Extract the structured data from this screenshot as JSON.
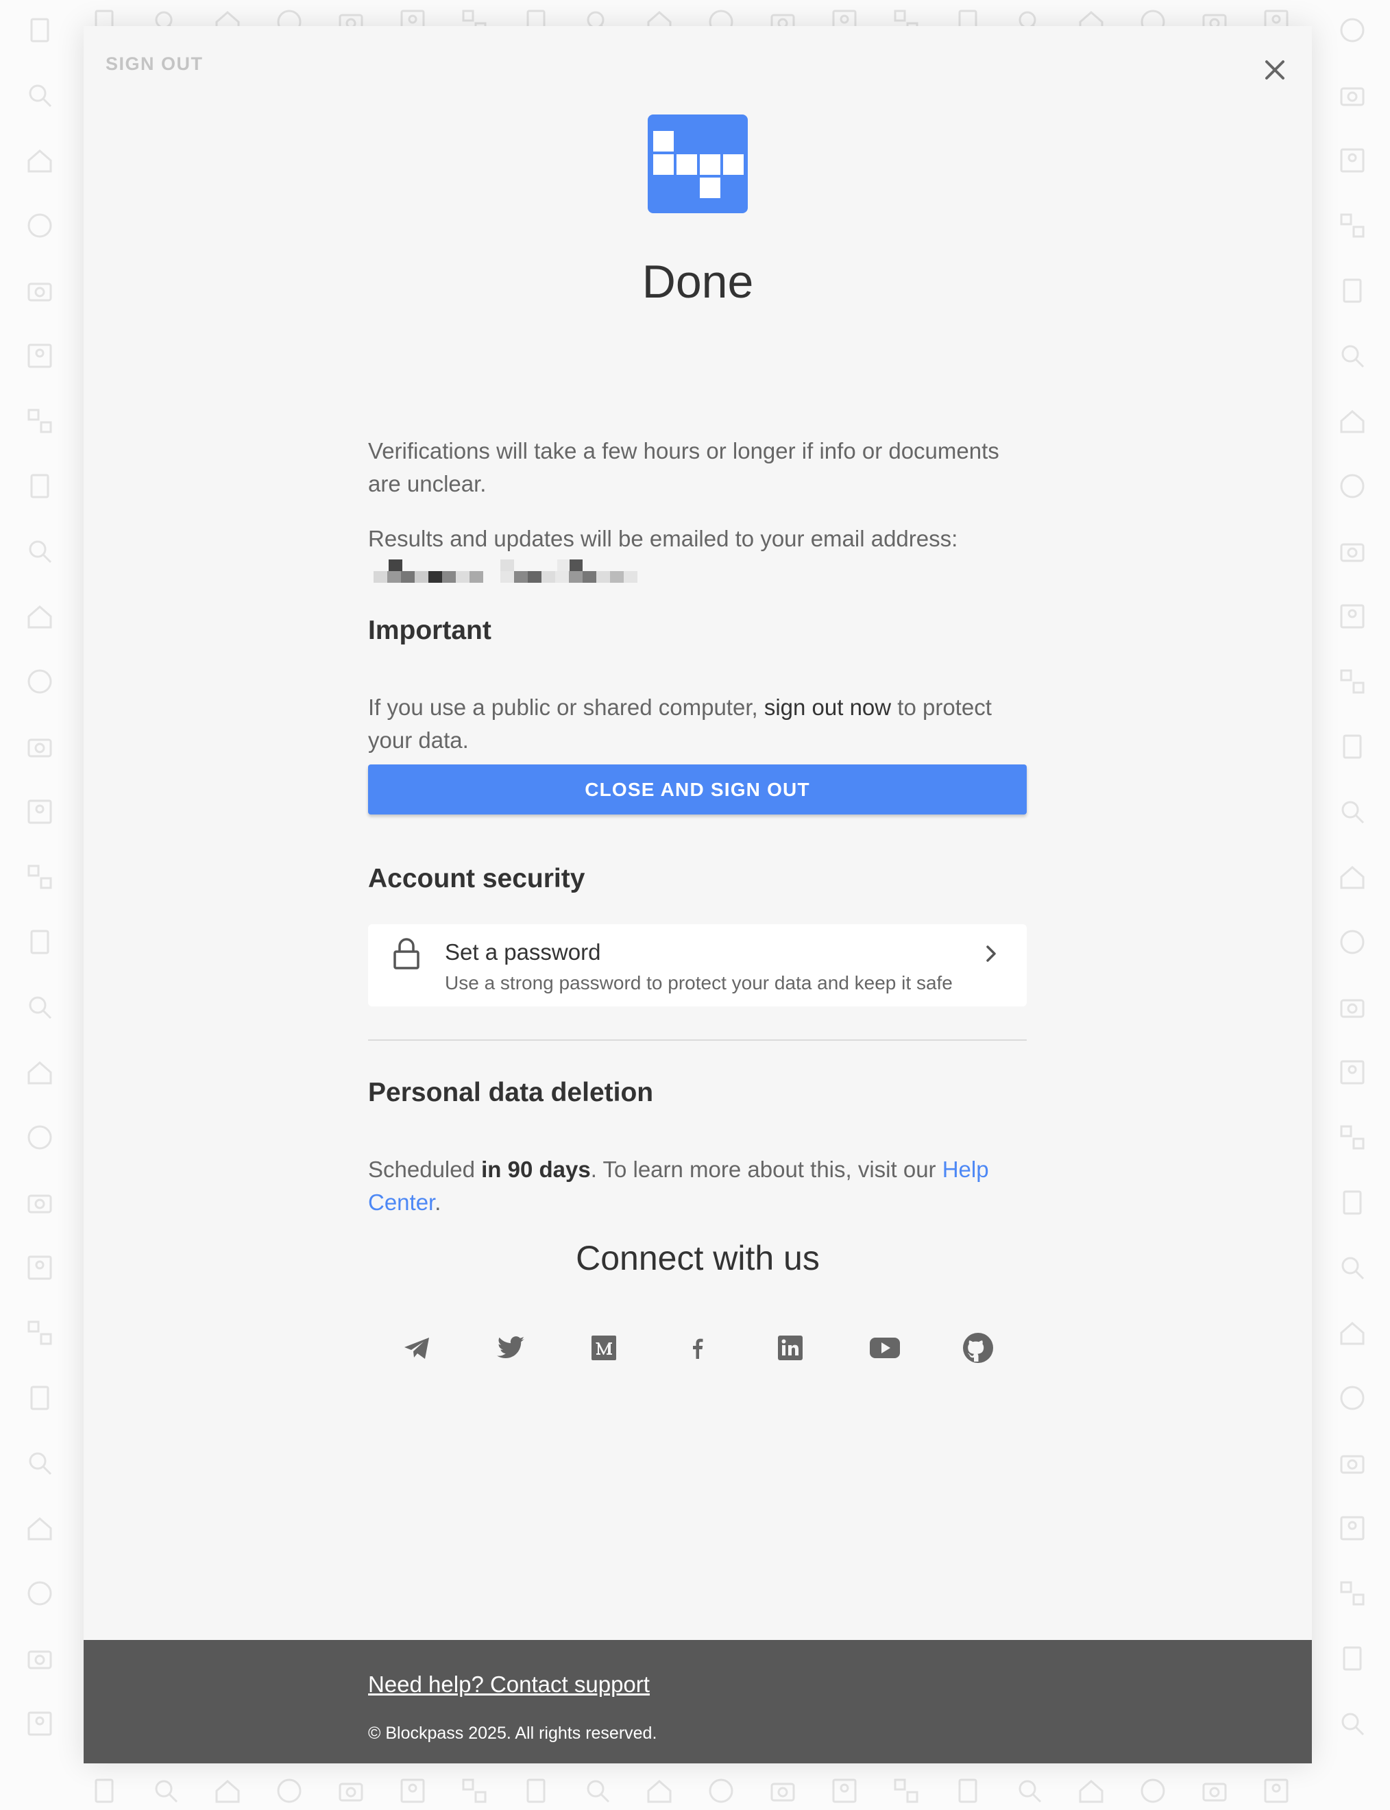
{
  "header": {
    "label": "SIGN OUT",
    "close_icon": "close-icon"
  },
  "logo": {
    "icon": "blockpass-logo",
    "color": "#4d88f5"
  },
  "title": "Done",
  "verification": {
    "text": "Verifications will take a few hours or longer if info or documents are unclear.",
    "email_notice": "Results and updates will be emailed to your email address:",
    "email_redacted": true
  },
  "important": {
    "heading": "Important",
    "text_before": "If you use a public or shared computer, ",
    "text_strong": "sign out now",
    "text_after": " to protect your data.",
    "button_label": "CLOSE AND SIGN OUT"
  },
  "security": {
    "heading": "Account security",
    "card_title": "Set a password",
    "card_subtitle": "Use a strong password to protect your data and keep it safe",
    "icon": "lock-icon"
  },
  "deletion": {
    "heading": "Personal data deletion",
    "text_before": "Scheduled ",
    "text_bold": "in 90 days",
    "text_middle": ". To learn more about this, visit our ",
    "link_label": "Help Center",
    "text_after": "."
  },
  "connect": {
    "heading": "Connect with us",
    "socials": [
      "telegram-icon",
      "twitter-icon",
      "medium-icon",
      "facebook-icon",
      "linkedin-icon",
      "youtube-icon",
      "github-icon"
    ]
  },
  "footer": {
    "support_link": "Need help? Contact support",
    "copyright": "© Blockpass 2025. All rights reserved."
  },
  "colors": {
    "accent": "#4d88f5",
    "footer_bg": "#585858",
    "modal_bg": "#f6f6f6"
  }
}
